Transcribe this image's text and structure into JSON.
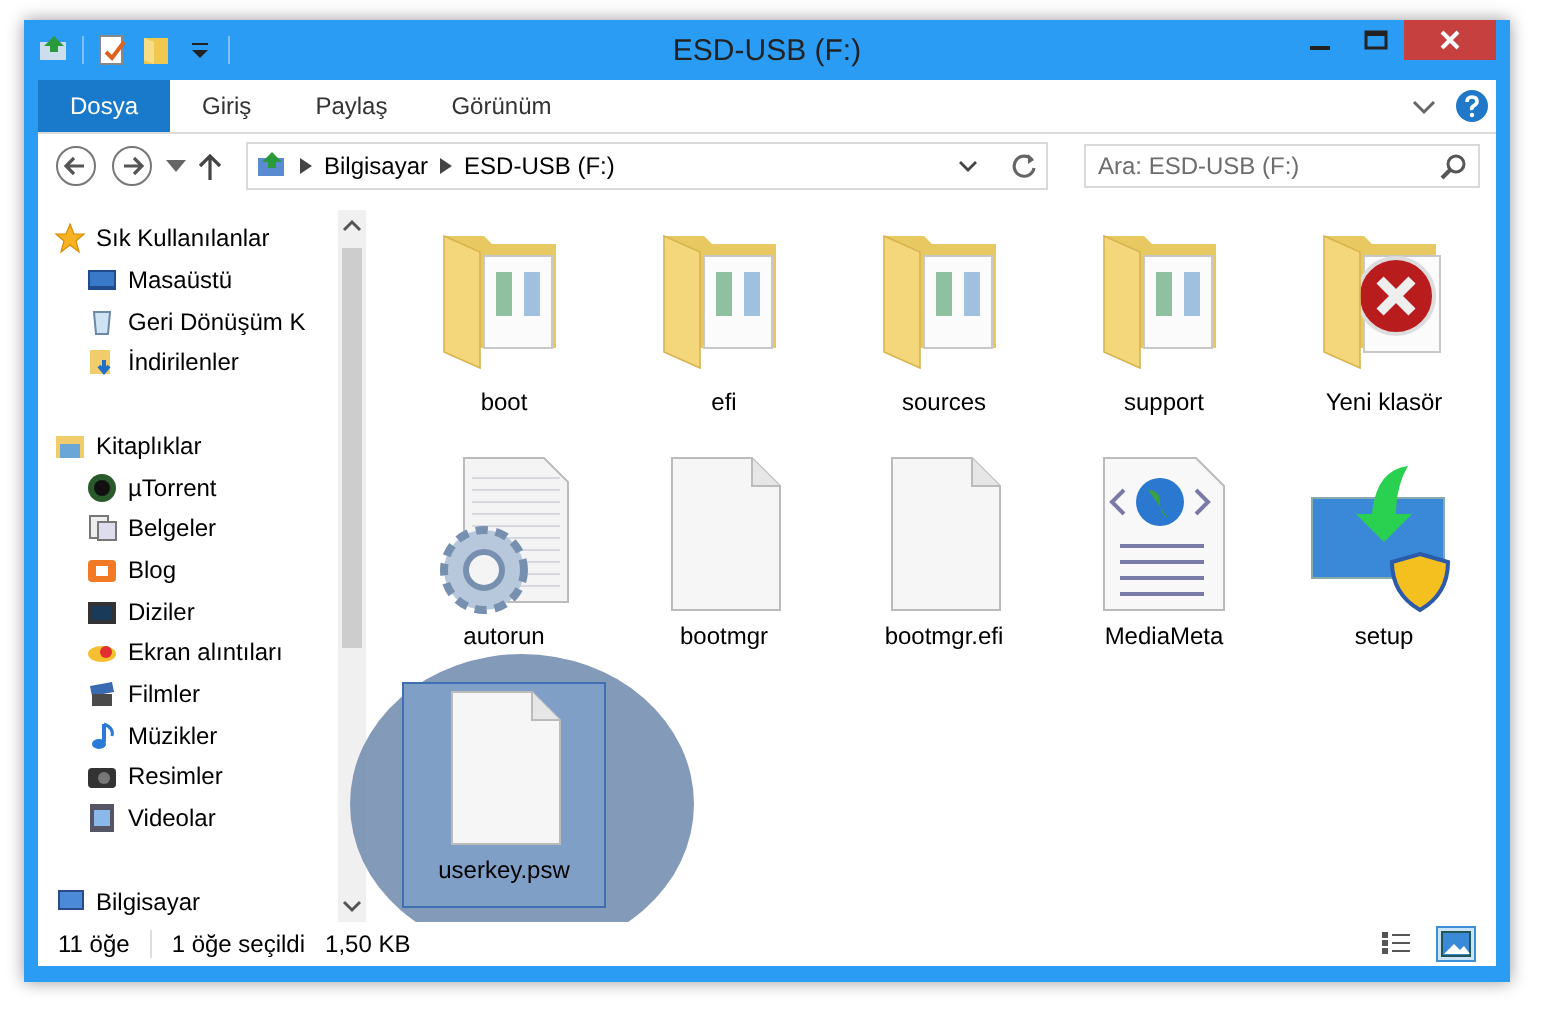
{
  "window": {
    "title": "ESD-USB (F:)"
  },
  "ribbon_tabs": [
    {
      "label": "Dosya",
      "selected": true
    },
    {
      "label": "Giriş",
      "selected": false
    },
    {
      "label": "Paylaş",
      "selected": false
    },
    {
      "label": "Görünüm",
      "selected": false
    }
  ],
  "address_bar": {
    "path": [
      "Bilgisayar",
      "ESD-USB (F:)"
    ]
  },
  "search": {
    "placeholder": "Ara: ESD-USB (F:)"
  },
  "sidebar": {
    "groups": [
      {
        "label": "Sık Kullanılanlar",
        "children": [
          {
            "label": "Masaüstü"
          },
          {
            "label": "Geri Dönüşüm K"
          },
          {
            "label": "İndirilenler"
          }
        ]
      },
      {
        "label": "Kitaplıklar",
        "children": [
          {
            "label": "µTorrent"
          },
          {
            "label": "Belgeler"
          },
          {
            "label": "Blog"
          },
          {
            "label": "Diziler"
          },
          {
            "label": "Ekran alıntıları"
          },
          {
            "label": "Filmler"
          },
          {
            "label": "Müzikler"
          },
          {
            "label": "Resimler"
          },
          {
            "label": "Videolar"
          }
        ]
      },
      {
        "label": "Bilgisayar"
      }
    ]
  },
  "files": [
    {
      "name": "boot",
      "kind": "folder",
      "selected": false
    },
    {
      "name": "efi",
      "kind": "folder",
      "selected": false
    },
    {
      "name": "sources",
      "kind": "folder",
      "selected": false
    },
    {
      "name": "support",
      "kind": "folder",
      "selected": false
    },
    {
      "name": "Yeni klasör",
      "kind": "folder-error",
      "selected": false
    },
    {
      "name": "autorun",
      "kind": "settings-file",
      "selected": false
    },
    {
      "name": "bootmgr",
      "kind": "blank-file",
      "selected": false
    },
    {
      "name": "bootmgr.efi",
      "kind": "blank-file",
      "selected": false
    },
    {
      "name": "MediaMeta",
      "kind": "web-file",
      "selected": false
    },
    {
      "name": "setup",
      "kind": "setup",
      "selected": false
    },
    {
      "name": "userkey.psw",
      "kind": "blank-file",
      "selected": true
    }
  ],
  "status_bar": {
    "count": "11 öğe",
    "selection": "1 öğe seçildi",
    "size": "1,50 KB"
  },
  "view_buttons": [
    {
      "kind": "details",
      "selected": false
    },
    {
      "kind": "large-icons",
      "selected": true
    }
  ]
}
